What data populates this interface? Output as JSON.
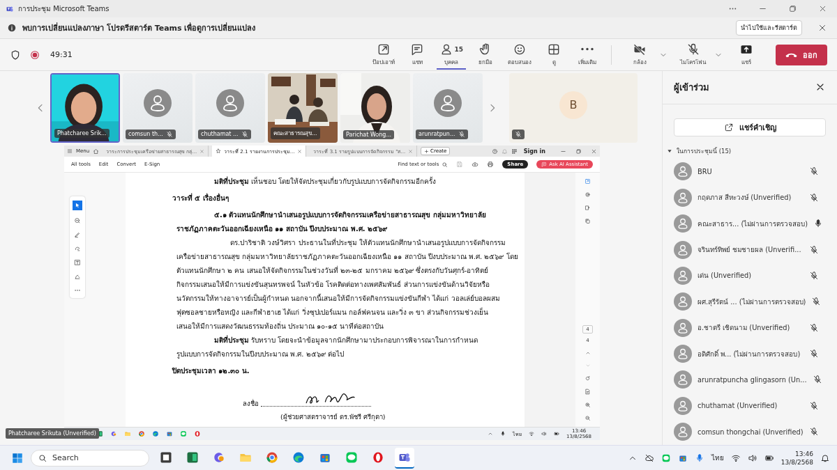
{
  "window": {
    "title": "การประชุม Microsoft Teams"
  },
  "notice": {
    "text": "พบการเปลี่ยนแปลงภาษา โปรดรีสตาร์ต Teams เพื่อดูการเปลี่ยนแปลง",
    "button": "นำไปใช้และรีสตาร์ต"
  },
  "meeting_bar": {
    "timer": "49:31",
    "recording": true,
    "actions": [
      {
        "kind": "popout",
        "label": "ป๊อปเอาท์",
        "selected": false
      },
      {
        "kind": "chat",
        "label": "แชท",
        "selected": false
      },
      {
        "kind": "people",
        "label": "บุคคล",
        "badge": "15",
        "selected": true
      },
      {
        "kind": "hand",
        "label": "ยกมือ",
        "selected": false
      },
      {
        "kind": "smile",
        "label": "ตอบสนอง",
        "selected": false
      },
      {
        "kind": "grid",
        "label": "ดู",
        "selected": false
      },
      {
        "kind": "dots",
        "label": "เพิ่มเติม",
        "selected": false
      }
    ],
    "devices": [
      {
        "kind": "camera",
        "label": "กล้อง",
        "on": false
      },
      {
        "kind": "mic",
        "label": "ไมโครโฟน",
        "on": false
      }
    ],
    "share": "แชร์",
    "leave": "ออก"
  },
  "video_strip": {
    "tiles": [
      {
        "name": "Phatcharee Srik...",
        "kind": "picture",
        "muted": false,
        "speaking": true
      },
      {
        "name": "comsun th...",
        "kind": "avatar",
        "muted": true,
        "speaking": false
      },
      {
        "name": "chuthamat ...",
        "kind": "avatar",
        "muted": true,
        "speaking": false
      },
      {
        "name": "คณะสาธารณสุข...",
        "kind": "picture",
        "muted": false,
        "speaking": false
      },
      {
        "name": "Parichat Wong...",
        "kind": "picture",
        "muted": false,
        "speaking": false
      },
      {
        "name": "arunratpun...",
        "kind": "avatar",
        "muted": true,
        "speaking": false
      }
    ],
    "overflow": {
      "initial": "B",
      "muted": true
    }
  },
  "pdf_window": {
    "menu": "Menu",
    "tabs": [
      {
        "label": "วาระการประชุมเครือข่ายสาธารณสุข กลุ่...",
        "selected": false
      },
      {
        "label": "วาระที่ 2.1 รายงานการประชุม...",
        "selected": true
      },
      {
        "label": "วาระที่ 3.1 รายรูปแบบการจัดกิจกรรม \"ส...",
        "selected": false
      }
    ],
    "create": "Create",
    "sign_in": "Sign in",
    "tools": [
      "All tools",
      "Edit",
      "Convert",
      "E-Sign"
    ],
    "find": "Find text or tools",
    "share": "Share",
    "ai": "Ask AI Assistant",
    "page": "4",
    "page_total": "4",
    "lines": [
      {
        "kind": "indent",
        "bold": false,
        "text": "**มติที่ประชุม** เห็นชอบ โดยให้จัดประชุมเกี่ยวกับรูปแบบการจัดกิจกรรมอีกครั้ง"
      },
      {
        "kind": "heading",
        "bold": true,
        "text": "วาระที่ ๕ เรื่องอื่นๆ"
      },
      {
        "kind": "indent",
        "bold": true,
        "text": "๕.๑ ตัวแทนนักศึกษานำเสนอรูปแบบการจัดกิจกรรมเครือข่ายสาธารณสุข กลุ่มมหาวิทยาลัย"
      },
      {
        "kind": "body",
        "bold": true,
        "text": "ราชภัฏภาคตะวันออกเฉียงเหนือ ๑๑ สถาบัน ปีงบประมาณ พ.ศ. ๒๕๖๙"
      },
      {
        "kind": "deep",
        "bold": false,
        "text": "ดร.ปาริชาติ  วงษ์วิศรา ประธานในที่ประชุม ให้ตัวแทนนักศึกษานำเสนอรูปแบบการจัดกิจกรรม"
      },
      {
        "kind": "body",
        "bold": false,
        "text": "เครือข่ายสาธารณสุข กลุ่มมหาวิทยาลัยราชภัฏภาคตะวันออกเฉียงเหนือ ๑๑ สถาบัน ปีงบประมาณ พ.ศ. ๒๕๖๙ โดย"
      },
      {
        "kind": "body",
        "bold": false,
        "text": "ตัวแทนนักศึกษา ๒ คน เสนอให้จัดกิจกรรมในช่วงวันที่ ๒๓-๒๕ มกราคม ๒๕๖๙ ซึ่งตรงกับวันศุกร์-อาทิตย์"
      },
      {
        "kind": "body",
        "bold": false,
        "text": "กิจกรรมเสนอให้มีการแข่งขันสุนทรพจน์ ในหัวข้อ โรคติดต่อทางเพศสัมพันธ์ ส่วนการแข่งขันด้านวิจัยหรือ"
      },
      {
        "kind": "body",
        "bold": false,
        "text": "นวัตกรรมให้ทางอาจารย์เป็นผู้กำหนด นอกจากนี้เสนอให้มีการจัดกิจกรรมแข่งขันกีฬา ได้แก่ วอลเล่ย์บอลผสม"
      },
      {
        "kind": "body",
        "bold": false,
        "text": "ฟุตซอลชายหรือหญิง และกีฬาฮาเฮ ได้แก่ วิ่งซุปเปอร์แมน กอล์ฟคนจน และวิ่ง ๓ ขา ส่วนกิจกรรมช่วงเย็น"
      },
      {
        "kind": "body",
        "bold": false,
        "text": "เสนอให้มีการแสดงวัฒนธรรมท้องถิ่น ประมาณ ๑๐-๑๕ นาทีต่อสถาบัน"
      },
      {
        "kind": "indent",
        "bold": false,
        "text": "**มติที่ประชุม** รับทราบ โดยจะนำข้อมูลจากนักศึกษามาประกอบการพิจารณาในการกำหนด"
      },
      {
        "kind": "body",
        "bold": false,
        "text": "รูปแบบการจัดกิจกรรมในปีงบประมาณ พ.ศ. ๒๕๖๙ ต่อไป"
      },
      {
        "kind": "heading",
        "bold": true,
        "text": "ปิดประชุมเวลา ๑๒.๓๐ น."
      }
    ],
    "signature": {
      "label": "ลงชื่อ",
      "name": "(ผู้ช่วยศาสตราจารย์ ดร.พัชรี ศรีกุตา)"
    }
  },
  "shared_taskbar": {
    "language": "ไทย",
    "time": "13:46",
    "date": "13/8/2568"
  },
  "tooltip": "Phatcharee Srikuta (Unverified)",
  "participants": {
    "title": "ผู้เข้าร่วม",
    "invite": "แชร์คำเชิญ",
    "section": "ในการประชุมนี้ (15)",
    "expanded": true,
    "people": [
      {
        "name": "BRU",
        "muted": true
      },
      {
        "name": "กฤดภาส สีหะวงษ์ (Unverified)",
        "muted": true
      },
      {
        "name": "คณะสาธาร... (ไม่ผ่านการตรวจสอบ)",
        "muted": false
      },
      {
        "name": "จรินทร์ทิพย์ ชมชายผล (Unverifi...",
        "muted": true
      },
      {
        "name": "เด่น (Unverified)",
        "muted": true
      },
      {
        "name": "ผศ.สุรีรัตน์ ... (ไม่ผ่านการตรวจสอบ)",
        "muted": true
      },
      {
        "name": "อ.ชาตรี เชิดนาม (Unverified)",
        "muted": true
      },
      {
        "name": "อดิศักดิ์ พ...  (ไม่ผ่านการตรวจสอบ)",
        "muted": true
      },
      {
        "name": "arunratpuncha glingasorn (Un...",
        "muted": true
      },
      {
        "name": "chuthamat (Unverified)",
        "muted": true
      },
      {
        "name": "comsun thongchai (Unverified)",
        "muted": true
      }
    ]
  },
  "taskbar": {
    "search_placeholder": "Search",
    "apps": [
      {
        "kind": "taskview",
        "selected": false
      },
      {
        "kind": "sheet",
        "selected": false
      },
      {
        "kind": "spark",
        "selected": false
      },
      {
        "kind": "folder",
        "selected": false
      },
      {
        "kind": "browser",
        "selected": false
      },
      {
        "kind": "wave",
        "selected": false
      },
      {
        "kind": "store",
        "selected": false
      },
      {
        "kind": "chatapp",
        "selected": false
      },
      {
        "kind": "ring",
        "selected": false
      },
      {
        "kind": "team",
        "selected": true
      }
    ],
    "language": "ไทย",
    "time": "13:46",
    "date": "13/8/2568"
  }
}
